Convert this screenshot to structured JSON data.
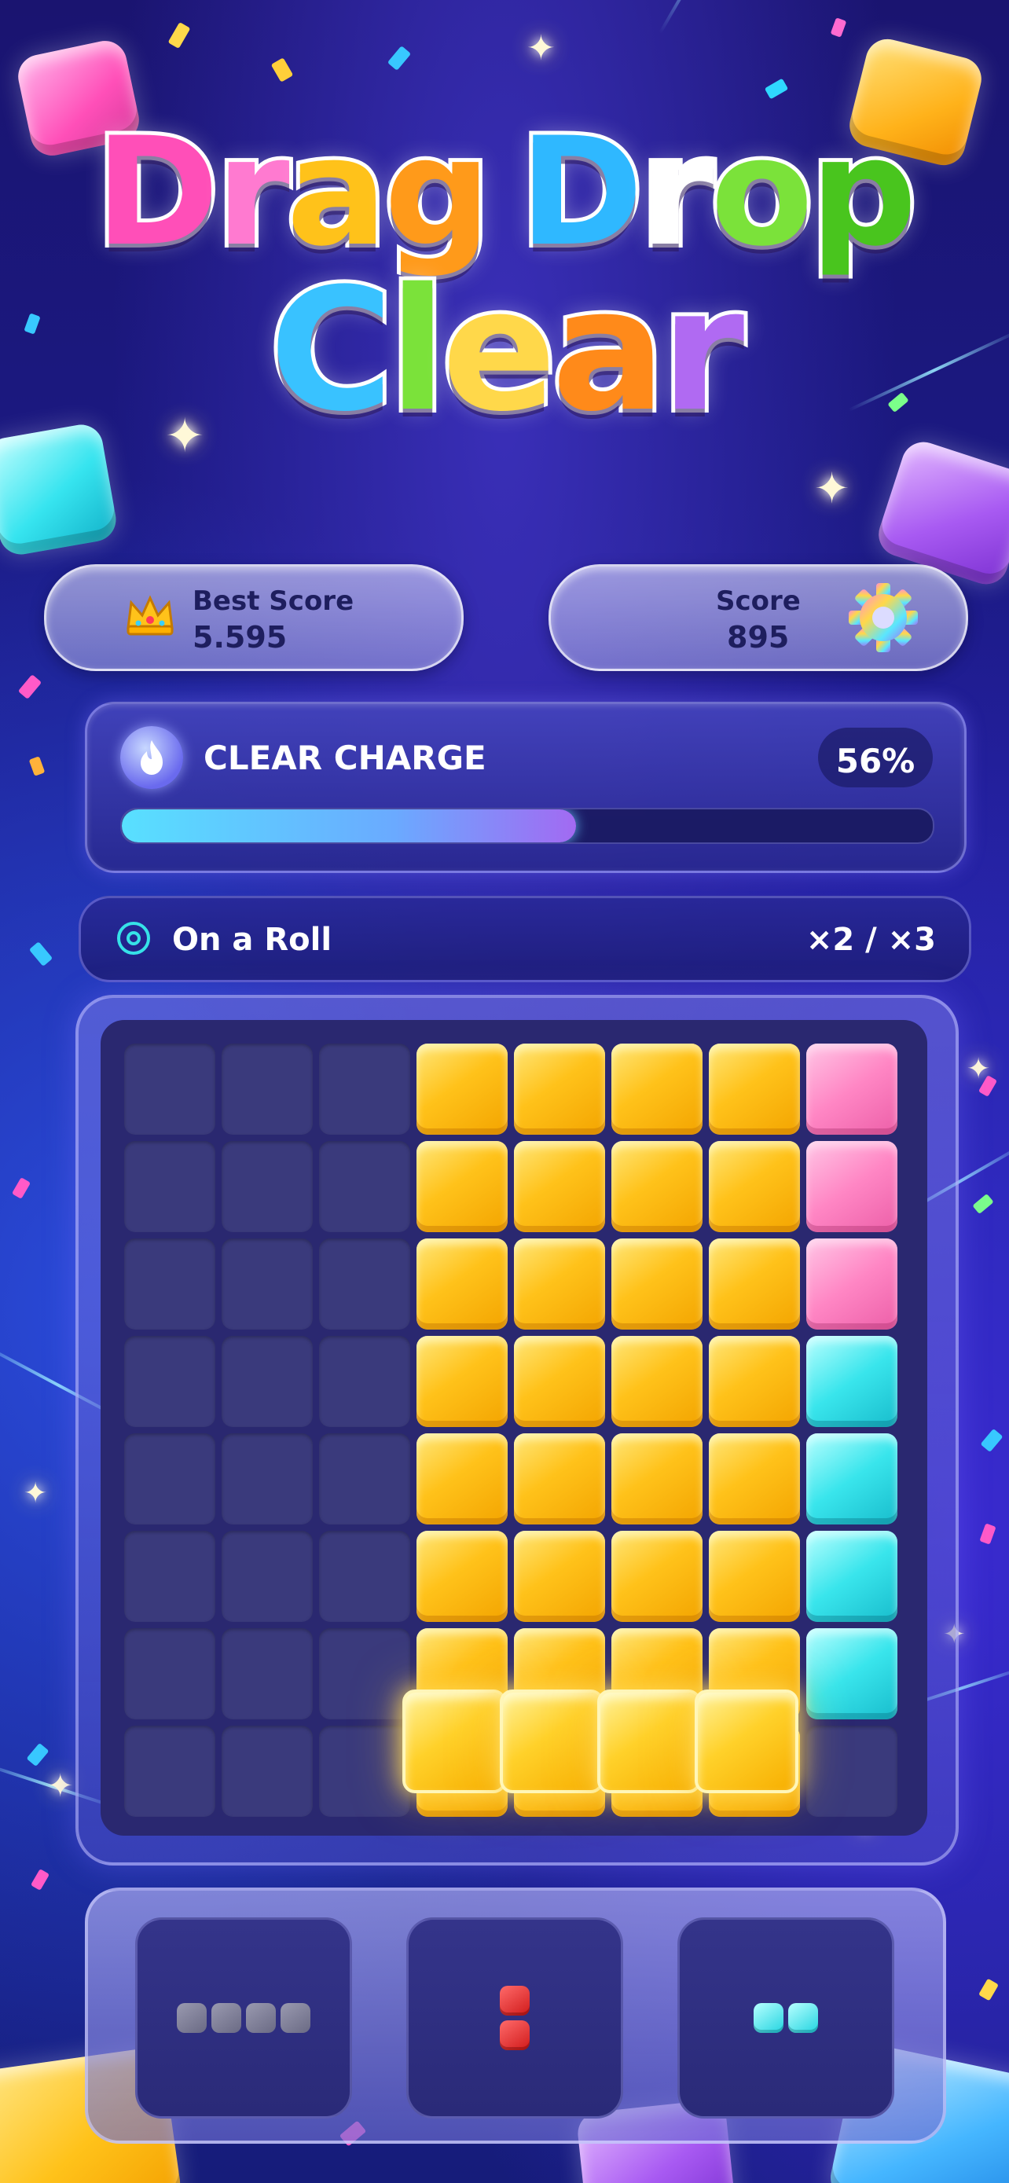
{
  "app": {
    "title_line1": "Drag Drop",
    "title_line2": "Clear"
  },
  "scores": {
    "best_label": "Best Score",
    "best_value": "5.595",
    "score_label": "Score",
    "score_value": "895",
    "crown_icon": "crown-icon",
    "settings_icon": "gear-icon"
  },
  "charge": {
    "label": "CLEAR CHARGE",
    "percent_text": "56%",
    "progress": 0.56,
    "icon": "flame-icon"
  },
  "streak": {
    "label": "On a Roll",
    "multiplier": "×2 / ×3",
    "icon": "target-icon"
  },
  "board": {
    "rows": 8,
    "cols": 8,
    "grid": [
      [
        "",
        "",
        "",
        "Y",
        "Y",
        "Y",
        "Y",
        "P"
      ],
      [
        "",
        "",
        "",
        "Y",
        "Y",
        "Y",
        "Y",
        "P"
      ],
      [
        "",
        "",
        "",
        "Y",
        "Y",
        "Y",
        "Y",
        "P"
      ],
      [
        "",
        "",
        "",
        "Y",
        "Y",
        "Y",
        "Y",
        "C"
      ],
      [
        "",
        "",
        "",
        "Y",
        "Y",
        "Y",
        "Y",
        "C"
      ],
      [
        "",
        "",
        "",
        "Y",
        "Y",
        "Y",
        "Y",
        "C"
      ],
      [
        "",
        "",
        "",
        "Y",
        "Y",
        "Y",
        "Y",
        "C"
      ],
      [
        "",
        "",
        "",
        "Y",
        "Y",
        "Y",
        "Y",
        ""
      ]
    ],
    "dragged_piece": {
      "color": "yellow",
      "row": 7,
      "cols": [
        3,
        4,
        5,
        6
      ]
    }
  },
  "tray": {
    "pieces": [
      {
        "name": "gray-line-4",
        "color": "gray",
        "shape": [
          [
            0,
            0
          ],
          [
            0,
            1
          ],
          [
            0,
            2
          ],
          [
            0,
            3
          ]
        ]
      },
      {
        "name": "red-vertical-2",
        "color": "red",
        "shape": [
          [
            0,
            0
          ],
          [
            1,
            0
          ]
        ]
      },
      {
        "name": "cyan-line-2",
        "color": "cyan",
        "shape": [
          [
            0,
            0
          ],
          [
            0,
            1
          ]
        ]
      }
    ]
  },
  "colors": {
    "yellow": "#ffc21a",
    "pink": "#ff86c4",
    "cyan": "#39e5ec",
    "empty": "#3a3a7c",
    "accent": "#58e0ff"
  }
}
